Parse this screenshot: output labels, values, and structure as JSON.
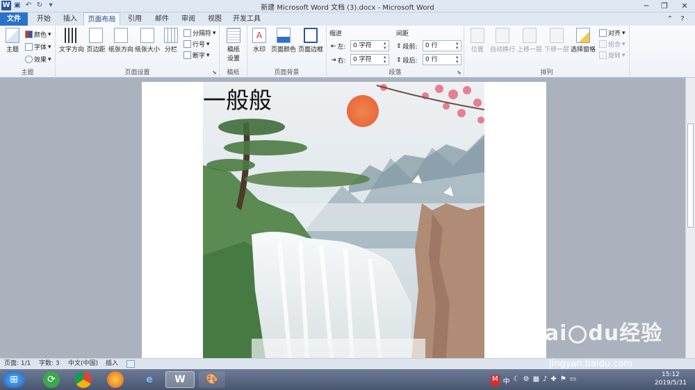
{
  "window": {
    "title": "新建 Microsoft Word 文档 (3).docx - Microsoft Word",
    "qat_icons": [
      "word-logo-icon",
      "save-icon",
      "undo-icon",
      "redo-icon",
      "customize-icon"
    ]
  },
  "tabs": [
    {
      "label": "文件",
      "active": false
    },
    {
      "label": "开始",
      "active": false
    },
    {
      "label": "插入",
      "active": false
    },
    {
      "label": "页面布局",
      "active": true
    },
    {
      "label": "引用",
      "active": false
    },
    {
      "label": "邮件",
      "active": false
    },
    {
      "label": "审阅",
      "active": false
    },
    {
      "label": "视图",
      "active": false
    },
    {
      "label": "开发工具",
      "active": false
    }
  ],
  "ribbon": {
    "theme": {
      "group_label": "主题",
      "themes_btn": "主题",
      "colors_btn": "颜色",
      "fonts_btn": "字体",
      "effects_btn": "效果"
    },
    "page_setup": {
      "group_label": "页面设置",
      "text_direction": "文字方向",
      "margins": "页边距",
      "orientation": "纸张方向",
      "size": "纸张大小",
      "columns": "分栏",
      "breaks": "分隔符",
      "line_numbers": "行号",
      "hyphenation": "断字"
    },
    "paper": {
      "group_label": "稿纸",
      "btn_line1": "稿纸",
      "btn_line2": "设置"
    },
    "page_background": {
      "group_label": "页面背景",
      "watermark": "水印",
      "page_color": "页面颜色",
      "page_borders": "页面边框"
    },
    "paragraph": {
      "group_label": "段落",
      "indent_label": "缩进",
      "spacing_label": "间距",
      "left_label": "左:",
      "left_value": "0 字符",
      "right_label": "右:",
      "right_value": "0 字符",
      "before_label": "段前:",
      "before_value": "0 行",
      "after_label": "段后:",
      "after_value": "0 行"
    },
    "arrange": {
      "group_label": "排列",
      "position": "位置",
      "wrap_text": "自动换行",
      "bring_forward": "上移一层",
      "send_backward": "下移一层",
      "selection_pane": "选择窗格",
      "align": "对齐",
      "group": "组合",
      "rotate": "旋转"
    }
  },
  "document": {
    "heading_text": "一般般",
    "picture_icon": "landscape-picture"
  },
  "status": {
    "page": "页面: 1/1",
    "words": "字数: 3",
    "language": "中文(中国)",
    "mode": "插入"
  },
  "taskbar": {
    "time": "15:12",
    "date": "2019/5/31",
    "tray_text": "中"
  },
  "watermark": {
    "brand": "Bai",
    "brand2": "du",
    "brand3": "经验",
    "url": "jingyan.baidu.com"
  }
}
